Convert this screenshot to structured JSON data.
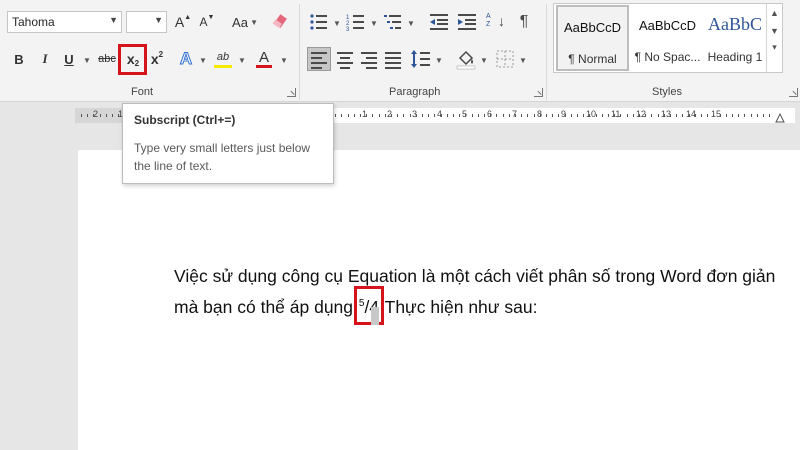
{
  "font_group": {
    "label": "Font",
    "font_name": "Tahoma",
    "font_size": "",
    "grow_label": "A",
    "shrink_label": "A",
    "change_case_label": "Aa",
    "bold_label": "B",
    "italic_label": "I",
    "underline_label": "U",
    "strike_label": "abc",
    "subscript_label": "x",
    "subscript_small": "2",
    "superscript_label": "x",
    "superscript_small": "2",
    "text_effects_label": "A",
    "highlight_label": "ab",
    "font_color_label": "A",
    "highlight_color": "#f7ec00",
    "font_color": "#d4141a"
  },
  "paragraph_group": {
    "label": "Paragraph",
    "sort_glyph": "A Z",
    "pilcrow": "¶"
  },
  "styles_group": {
    "label": "Styles",
    "items": [
      {
        "preview": "AaBbCcD",
        "name": "¶ Normal"
      },
      {
        "preview": "AaBbCcD",
        "name": "¶ No Spac..."
      },
      {
        "preview": "AaBbC",
        "name": "Heading 1"
      }
    ]
  },
  "ruler": {
    "numbers": [
      "2",
      "1",
      "1",
      "2",
      "3",
      "4",
      "5",
      "6",
      "7",
      "8",
      "9",
      "10",
      "11",
      "12",
      "13",
      "14",
      "15"
    ]
  },
  "tooltip": {
    "title": "Subscript (Ctrl+=)",
    "body": "Type very small letters just below the line of text."
  },
  "document": {
    "line1": "Việc sử dụng công cụ Equation là một cách viết phân số trong Word đơn giản",
    "line2_before": "mà bạn có thể áp dụng",
    "frac_num": "5",
    "frac_rest": "/4",
    "line2_after": " Thực hiện như sau:"
  },
  "accent": {
    "highlight_border": "#d4141a",
    "heading_color": "#2e5597"
  }
}
